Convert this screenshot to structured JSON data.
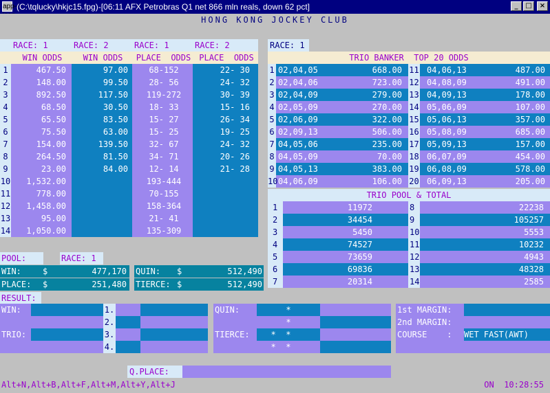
{
  "window": {
    "title": "(C:\\tqlucky\\hkjc15.fpg)-[06:11 AFX  Petrobras Q1 net 866 mln reals, down 62 pct]",
    "icon": "app-icon",
    "min": "_",
    "max": "□",
    "close": "×"
  },
  "header": {
    "title": "HONG KONG JOCKEY CLUB"
  },
  "odds": {
    "col_heads": [
      {
        "race": "RACE: 1",
        "label": "WIN ODDS"
      },
      {
        "race": "RACE: 2",
        "label": "WIN ODDS"
      },
      {
        "race": "RACE: 1",
        "label": "PLACE  ODDS"
      },
      {
        "race": "RACE: 2",
        "label": "PLACE  ODDS"
      }
    ],
    "rows": [
      {
        "n": "1",
        "w1": "467.50",
        "w2": "97.00",
        "p1": "68-152",
        "p2": "22- 30"
      },
      {
        "n": "2",
        "w1": "148.00",
        "w2": "99.50",
        "p1": "28- 56",
        "p2": "24- 32"
      },
      {
        "n": "3",
        "w1": "892.50",
        "w2": "117.50",
        "p1": "119-272",
        "p2": "30- 39"
      },
      {
        "n": "4",
        "w1": "68.50",
        "w2": "30.50",
        "p1": "18- 33",
        "p2": "15- 16"
      },
      {
        "n": "5",
        "w1": "65.50",
        "w2": "83.50",
        "p1": "15- 27",
        "p2": "26- 34"
      },
      {
        "n": "6",
        "w1": "75.50",
        "w2": "63.00",
        "p1": "15- 25",
        "p2": "19- 25"
      },
      {
        "n": "7",
        "w1": "154.00",
        "w2": "139.50",
        "p1": "32- 67",
        "p2": "24- 32"
      },
      {
        "n": "8",
        "w1": "264.50",
        "w2": "81.50",
        "p1": "34- 71",
        "p2": "20- 26"
      },
      {
        "n": "9",
        "w1": "23.00",
        "w2": "84.00",
        "p1": "12- 14",
        "p2": "21- 28"
      },
      {
        "n": "10",
        "w1": "1,532.00",
        "w2": "",
        "p1": "193-444",
        "p2": ""
      },
      {
        "n": "11",
        "w1": "778.00",
        "w2": "",
        "p1": "70-155",
        "p2": ""
      },
      {
        "n": "12",
        "w1": "1,458.00",
        "w2": "",
        "p1": "158-364",
        "p2": ""
      },
      {
        "n": "13",
        "w1": "95.00",
        "w2": "",
        "p1": "21- 41",
        "p2": ""
      },
      {
        "n": "14",
        "w1": "1,050.00",
        "w2": "",
        "p1": "135-309",
        "p2": ""
      }
    ]
  },
  "trio": {
    "race": "RACE: 1",
    "title": "TRIO BANKER  TOP 20 ODDS",
    "left": [
      {
        "n": "1",
        "combo": "02,04,05",
        "odds": "668.00"
      },
      {
        "n": "2",
        "combo": "02,04,06",
        "odds": "723.00"
      },
      {
        "n": "3",
        "combo": "02,04,09",
        "odds": "279.00"
      },
      {
        "n": "4",
        "combo": "02,05,09",
        "odds": "270.00"
      },
      {
        "n": "5",
        "combo": "02,06,09",
        "odds": "322.00"
      },
      {
        "n": "6",
        "combo": "02,09,13",
        "odds": "506.00"
      },
      {
        "n": "7",
        "combo": "04,05,06",
        "odds": "235.00"
      },
      {
        "n": "8",
        "combo": "04,05,09",
        "odds": "70.00"
      },
      {
        "n": "9",
        "combo": "04,05,13",
        "odds": "383.00"
      },
      {
        "n": "10",
        "combo": "04,06,09",
        "odds": "106.00"
      }
    ],
    "right": [
      {
        "n": "11",
        "combo": "04,06,13",
        "odds": "487.00"
      },
      {
        "n": "12",
        "combo": "04,08,09",
        "odds": "491.00"
      },
      {
        "n": "13",
        "combo": "04,09,13",
        "odds": "178.00"
      },
      {
        "n": "14",
        "combo": "05,06,09",
        "odds": "107.00"
      },
      {
        "n": "15",
        "combo": "05,06,13",
        "odds": "357.00"
      },
      {
        "n": "16",
        "combo": "05,08,09",
        "odds": "685.00"
      },
      {
        "n": "17",
        "combo": "05,09,13",
        "odds": "157.00"
      },
      {
        "n": "18",
        "combo": "06,07,09",
        "odds": "454.00"
      },
      {
        "n": "19",
        "combo": "06,08,09",
        "odds": "578.00"
      },
      {
        "n": "20",
        "combo": "06,09,13",
        "odds": "205.00"
      }
    ],
    "pool_title": "TRIO POOL & TOTAL",
    "pool_left": [
      {
        "n": "1",
        "v": "11972"
      },
      {
        "n": "2",
        "v": "34454"
      },
      {
        "n": "3",
        "v": "5450"
      },
      {
        "n": "4",
        "v": "74527"
      },
      {
        "n": "5",
        "v": "73659"
      },
      {
        "n": "6",
        "v": "69836"
      },
      {
        "n": "7",
        "v": "20314"
      }
    ],
    "pool_right": [
      {
        "n": "8",
        "v": "22238"
      },
      {
        "n": "9",
        "v": "105257"
      },
      {
        "n": "10",
        "v": "5553"
      },
      {
        "n": "11",
        "v": "10232"
      },
      {
        "n": "12",
        "v": "4943"
      },
      {
        "n": "13",
        "v": "48328"
      },
      {
        "n": "14",
        "v": "2585"
      }
    ]
  },
  "pool": {
    "label": "POOL:",
    "race": "RACE: 1",
    "win_label": "WIN:",
    "win_cur": "$",
    "win_value": "477,170",
    "place_label": "PLACE:",
    "place_cur": "$",
    "place_value": "251,480",
    "quin_label": "QUIN:",
    "quin_cur": "$",
    "quin_value": "512,490",
    "tierce_label": "TIERCE:",
    "tierce_cur": "$",
    "tierce_value": "512,490"
  },
  "result": {
    "label": "RESULT:",
    "win_label": "WIN:",
    "trio_label": "TRIO:",
    "places": [
      "1.",
      "2.",
      "3.",
      "4."
    ],
    "quin_label": "QUIN:",
    "tierce_label": "TIERCE:",
    "quin_marks": [
      "*",
      "*"
    ],
    "tierce_marks": [
      "*  *",
      "*  *"
    ],
    "margin1_label": "1st MARGIN:",
    "margin2_label": "2nd MARGIN:",
    "course_label": "COURSE    :",
    "course_value": "WET FAST(AWT)",
    "qplace_label": "Q.PLACE:"
  },
  "footer": {
    "shortcuts": "Alt+N,Alt+B,Alt+F,Alt+M,Alt+Y,Alt+J",
    "clock": "ON  10:28:55"
  },
  "colors": {
    "violet": "#9c87ee",
    "blue": "#0f80c0",
    "teal": "#07829f",
    "light": "#d8eaf8",
    "gray": "#c0c0c0",
    "label": "#9900cc",
    "navy": "#000080"
  }
}
